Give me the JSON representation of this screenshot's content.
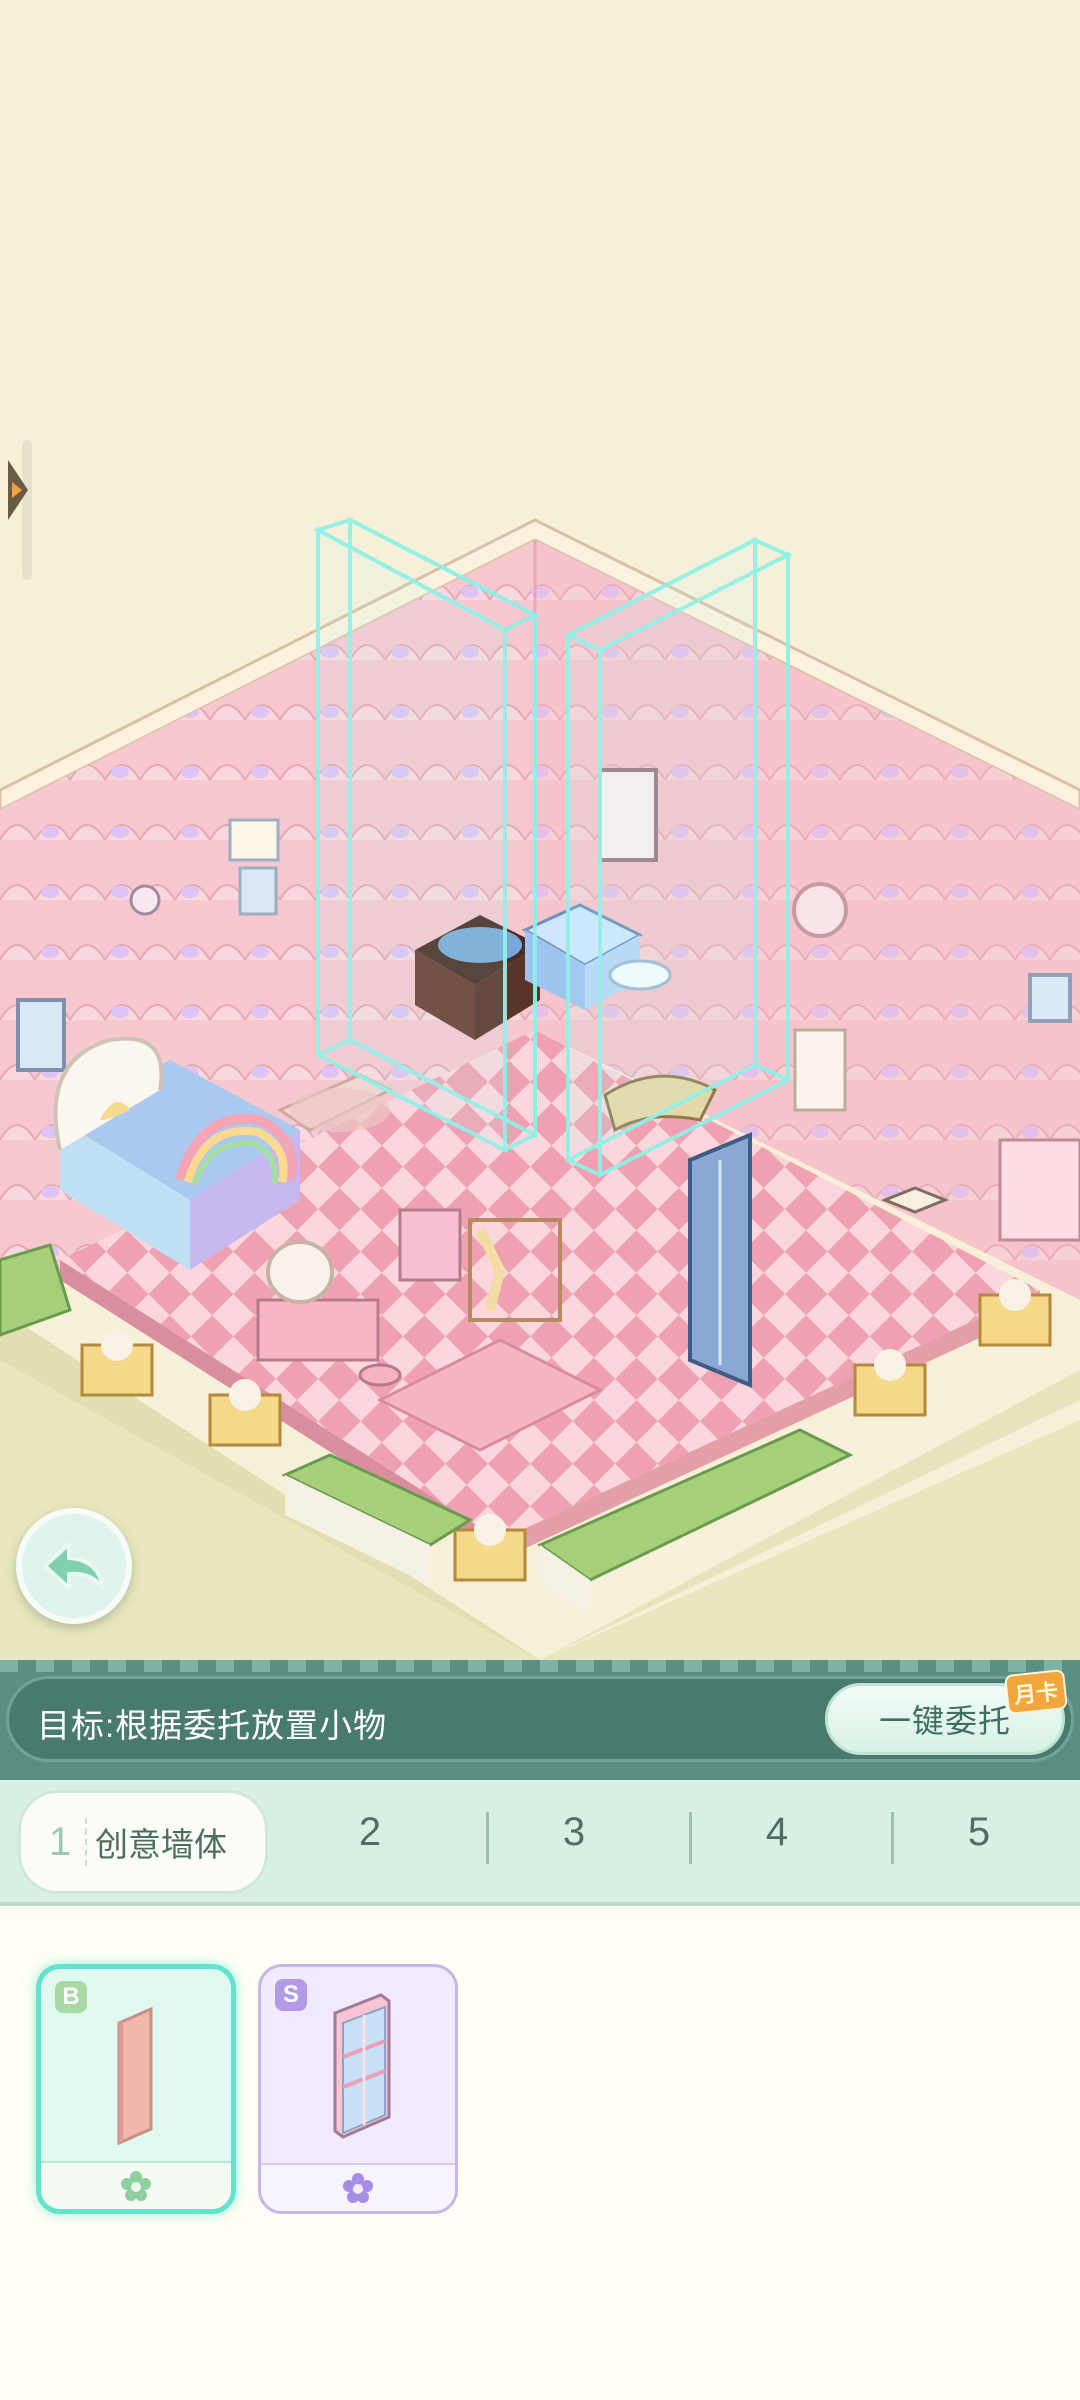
{
  "goal": {
    "text": "目标:根据委托放置小物",
    "delegate_button_label": "一键委托",
    "badge": "月卡"
  },
  "tabs": [
    {
      "number": "1",
      "label": "创意墙体",
      "selected": true
    },
    {
      "number": "2"
    },
    {
      "number": "3"
    },
    {
      "number": "4"
    },
    {
      "number": "5"
    }
  ],
  "items": [
    {
      "rank": "B",
      "selected": true,
      "name_icon": "wall-panel-icon"
    },
    {
      "rank": "S",
      "selected": false,
      "name_icon": "wall-shelf-icon"
    }
  ],
  "colors": {
    "wall_pink": "#f4c4cd",
    "floor_pink": "#f2a7b5",
    "teal_accent": "#63e3cc",
    "goal_bar": "#497a70"
  }
}
